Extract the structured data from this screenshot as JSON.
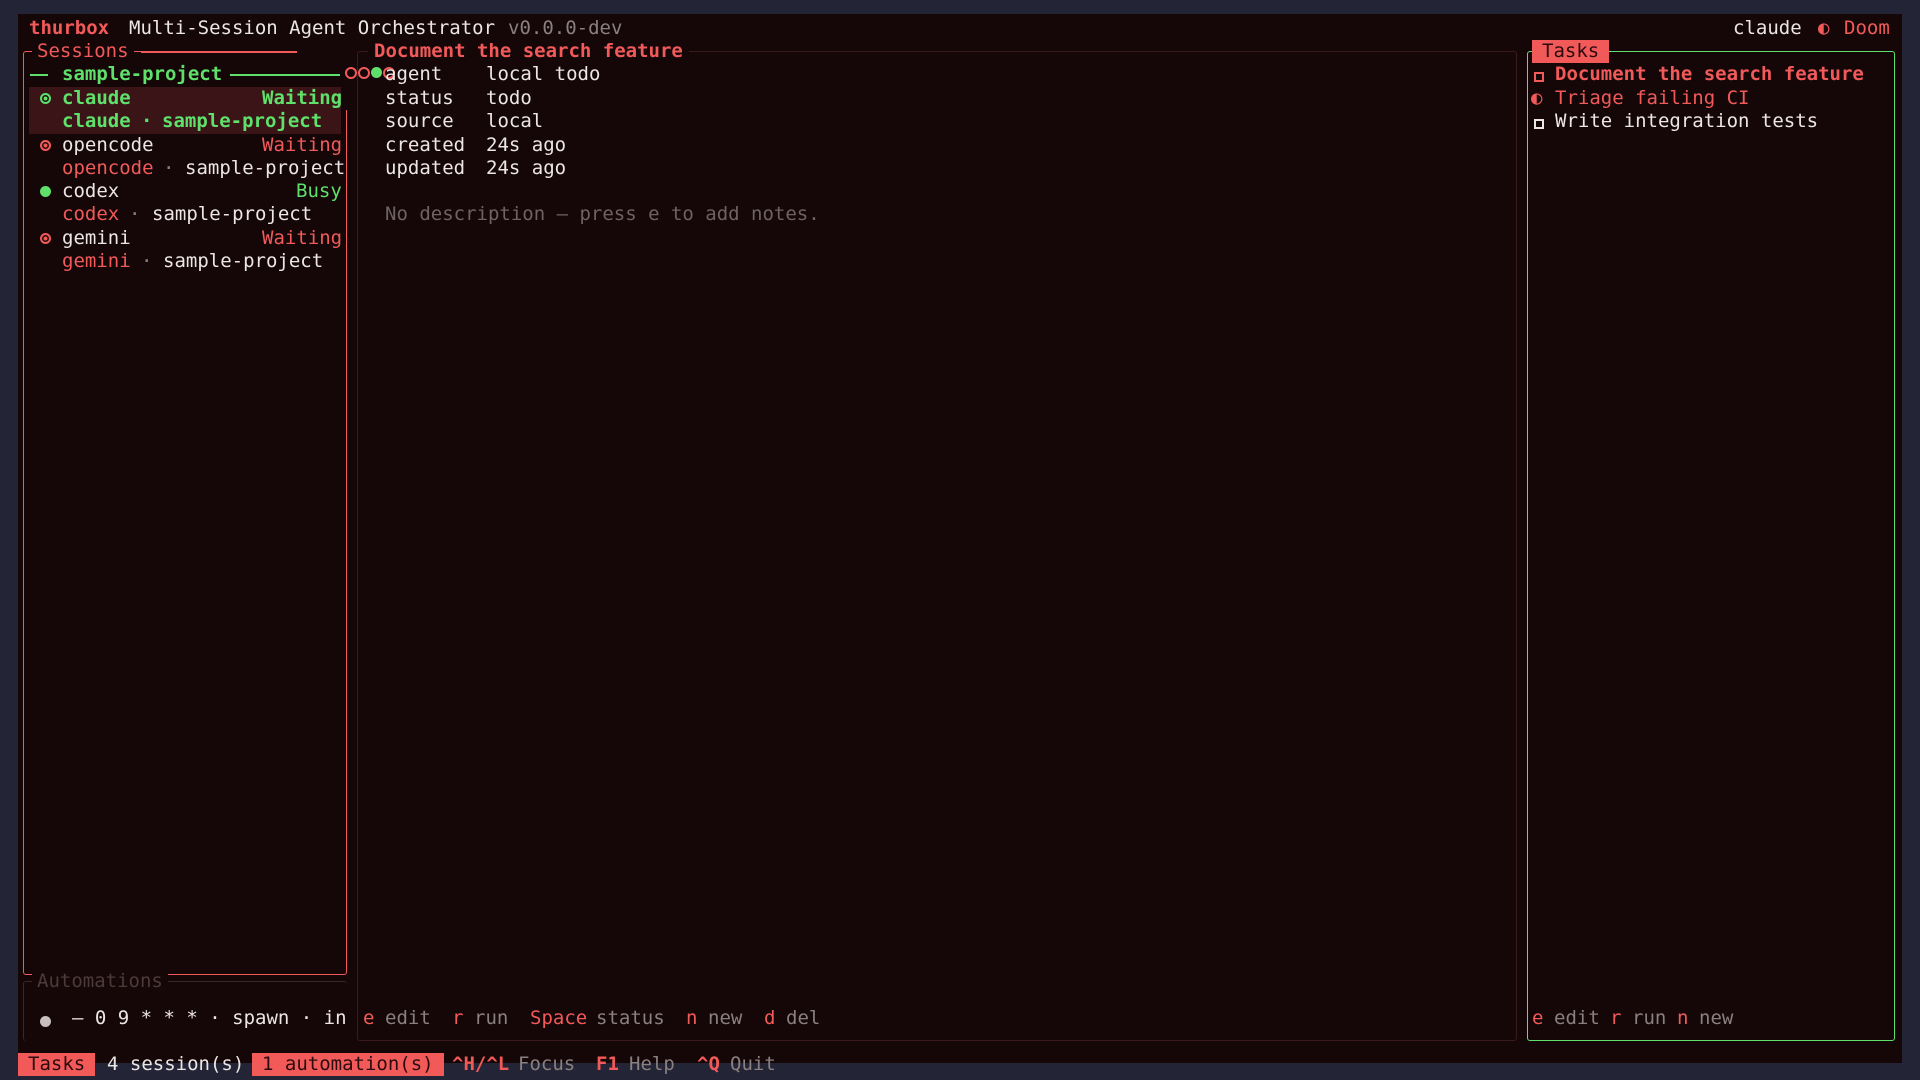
{
  "header": {
    "app_name": "thurbox",
    "subtitle": "Multi-Session Agent Orchestrator",
    "version": "v0.0.0-dev",
    "agent": "claude",
    "theme_icon": "◐",
    "theme": "Doom"
  },
  "sessions": {
    "title": "Sessions",
    "group": "sample-project",
    "items": [
      {
        "name": "claude",
        "status": "Waiting",
        "agent": "claude",
        "sep": "·",
        "project": "sample-project"
      },
      {
        "name": "opencode",
        "status": "Waiting",
        "agent": "opencode",
        "sep": "·",
        "project": "sample-project"
      },
      {
        "name": "codex",
        "status": "Busy",
        "agent": "codex",
        "sep": "·",
        "project": "sample-project"
      },
      {
        "name": "gemini",
        "status": "Waiting",
        "agent": "gemini",
        "sep": "·",
        "project": "sample-project"
      }
    ]
  },
  "automations": {
    "title": "Automations",
    "schedule": "— 0 9 * * * · spawn · in"
  },
  "detail": {
    "title": "Document the search feature",
    "fields": [
      {
        "key": "agent",
        "value": "local todo"
      },
      {
        "key": "status",
        "value": "todo"
      },
      {
        "key": "source",
        "value": "local"
      },
      {
        "key": "created",
        "value": "24s ago"
      },
      {
        "key": "updated",
        "value": "24s ago"
      }
    ],
    "empty_note": "No description — press e to add notes.",
    "shortcuts": [
      {
        "key": "e",
        "label": "edit"
      },
      {
        "key": "r",
        "label": "run"
      },
      {
        "key": "Space",
        "label": "status"
      },
      {
        "key": "n",
        "label": "new"
      },
      {
        "key": "d",
        "label": "del"
      }
    ]
  },
  "tasks": {
    "title": "Tasks",
    "items": [
      {
        "label": "Document the search feature",
        "icon": "square-icon"
      },
      {
        "label": "Triage failing CI",
        "icon": "half-circle-icon",
        "glyph": "◐"
      },
      {
        "label": "Write integration tests",
        "icon": "square-icon"
      }
    ],
    "shortcuts": [
      {
        "key": "e",
        "label": "edit"
      },
      {
        "key": "r",
        "label": "run"
      },
      {
        "key": "n",
        "label": "new"
      }
    ]
  },
  "statusbar": {
    "mode": "Tasks",
    "sessions": "4 session(s)",
    "automations": "1 automation(s)",
    "focus_key": "^H/^L",
    "focus_label": "Focus",
    "help_key": "F1",
    "help_label": "Help",
    "quit_key": "^Q",
    "quit_label": "Quit"
  },
  "colors": {
    "accent_red": "#f25a5a",
    "accent_green": "#5fe06b",
    "background": "#150708",
    "selection": "#3a1416"
  }
}
